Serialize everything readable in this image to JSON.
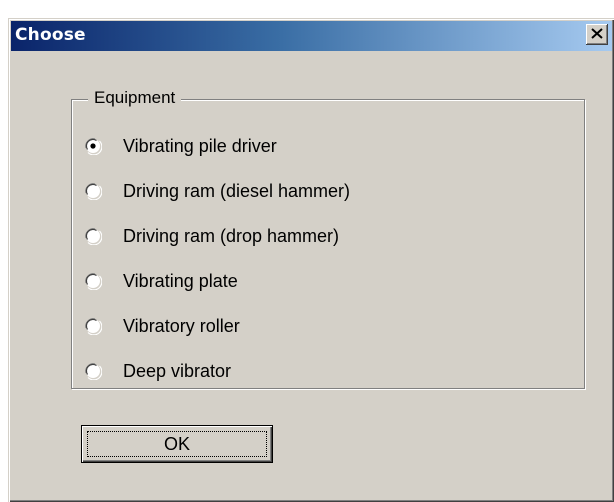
{
  "window": {
    "title": "Choose",
    "close_glyph": "close-icon"
  },
  "equipment": {
    "legend": "Equipment",
    "selected_index": 0,
    "options": [
      {
        "label": "Vibrating pile driver",
        "checked": true
      },
      {
        "label": "Driving ram (diesel hammer)",
        "checked": false
      },
      {
        "label": "Driving ram (drop hammer)",
        "checked": false
      },
      {
        "label": "Vibrating plate",
        "checked": false
      },
      {
        "label": "Vibratory roller",
        "checked": false
      },
      {
        "label": "Deep vibrator",
        "checked": false
      }
    ]
  },
  "buttons": {
    "ok_label": "OK"
  },
  "colors": {
    "face": "#d4d0c8",
    "title_start": "#0a246a",
    "title_end": "#a6caf0",
    "title_text": "#ffffff"
  }
}
